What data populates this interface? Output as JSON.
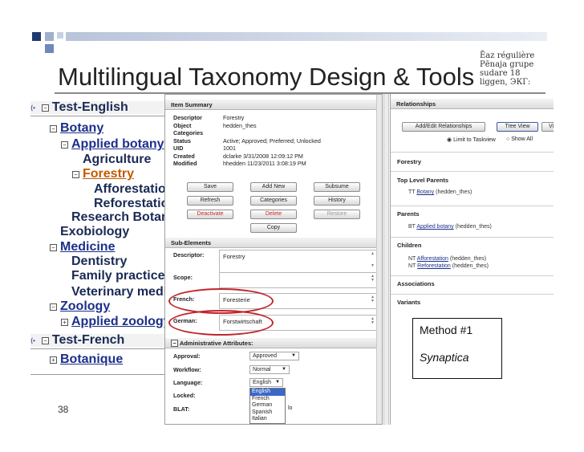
{
  "slide": {
    "title": "Multilingual Taxonomy Design & Tools",
    "page_number": "38",
    "stamp_lines": [
      "Ēaz régulière",
      "Pēnaja grupe",
      "sudare 18",
      "liggen, ЭКГ:"
    ]
  },
  "tree": {
    "rows": [
      {
        "label": "Test-English",
        "toggle": "⊟",
        "level": 0,
        "root": true,
        "style": ""
      },
      {
        "label": "Botany",
        "toggle": "⊟",
        "level": 1,
        "style": "u"
      },
      {
        "label": "Applied botany",
        "toggle": "⊟",
        "level": 2,
        "style": "u"
      },
      {
        "label": "Agriculture",
        "toggle": "",
        "level": 3,
        "style": ""
      },
      {
        "label": "Forestry",
        "toggle": "⊟",
        "level": 3,
        "style": "sel"
      },
      {
        "label": "Afforestation",
        "toggle": "",
        "level": 4,
        "style": ""
      },
      {
        "label": "Reforestation",
        "toggle": "",
        "level": 4,
        "style": ""
      },
      {
        "label": "Research Botany",
        "toggle": "",
        "level": 2,
        "style": ""
      },
      {
        "label": "Exobiology",
        "toggle": "",
        "level": 1,
        "style": ""
      },
      {
        "label": "Medicine",
        "toggle": "⊟",
        "level": 1,
        "style": "u"
      },
      {
        "label": "Dentistry",
        "toggle": "",
        "level": 2,
        "style": ""
      },
      {
        "label": "Family practice",
        "toggle": "",
        "level": 2,
        "style": ""
      },
      {
        "label": "Veterinary medicine",
        "toggle": "",
        "level": 2,
        "style": ""
      },
      {
        "label": "Zoology",
        "toggle": "⊟",
        "level": 1,
        "style": "u"
      },
      {
        "label": "Applied zoology",
        "toggle": "⊞",
        "level": 2,
        "style": "u"
      },
      {
        "label": "Test-French",
        "toggle": "⊟",
        "level": 0,
        "root": true,
        "style": ""
      },
      {
        "label": "Botanique",
        "toggle": "⊞",
        "level": 1,
        "style": "u"
      }
    ]
  },
  "item_summary": {
    "header": "Item Summary",
    "fields": [
      {
        "k": "Descriptor",
        "v": "Forestry"
      },
      {
        "k": "Object",
        "v": "hedden_thes"
      },
      {
        "k": "Categories",
        "v": ""
      },
      {
        "k": "Status",
        "v": "Active; Approved; Preferred; Unlocked"
      },
      {
        "k": "UID",
        "v": "1001"
      },
      {
        "k": "Created",
        "v": "dclarke 3/31/2008 12:09:12 PM"
      },
      {
        "k": "Modified",
        "v": "hhedden 11/23/2011 3:08:19 PM"
      }
    ],
    "buttons": {
      "save": "Save",
      "add_new": "Add New",
      "subsume": "Subsume",
      "refresh": "Refresh",
      "categories": "Categories",
      "history": "History",
      "deactivate": "Deactivate",
      "delete": "Delete",
      "restore": "Restore",
      "copy": "Copy"
    }
  },
  "sub_elements": {
    "header": "Sub-Elements",
    "descriptor_label": "Descriptor:",
    "descriptor_value": "Forestry",
    "scope_label": "Scope:",
    "scope_value": "",
    "french_label": "French:",
    "french_value": "Foresterie",
    "german_label": "German:",
    "german_value": "Forstwirtschaft"
  },
  "admin": {
    "header": "Administrative Attributes:",
    "approval_label": "Approval:",
    "approval_value": "Approved",
    "workflow_label": "Workflow:",
    "workflow_value": "Normal",
    "language_label": "Language:",
    "language_value": "English",
    "locked_label": "Locked:",
    "blat_label": "BLAT:",
    "blat_value": "lo",
    "language_options": [
      "English",
      "French",
      "German",
      "Spanish",
      "Italian"
    ]
  },
  "relationships": {
    "header": "Relationships",
    "add_edit_button": "Add/Edit Relationships",
    "tree_view_button": "Tree View",
    "third_button": "Vi",
    "limit_label": "Limit to Taskview",
    "show_all_label": "Show All",
    "term": "Forestry",
    "top_level_label": "Top Level Parents",
    "top_level_item": {
      "prefix": "TT",
      "link": "Botany",
      "suffix": "(hedden_thes)"
    },
    "parents_label": "Parents",
    "parents_item": {
      "prefix": "BT",
      "link": "Applied botany",
      "suffix": "(hedden_thes)"
    },
    "children_label": "Children",
    "children_items": [
      {
        "prefix": "NT",
        "link": "Afforestation",
        "suffix": "(hedden_thes)"
      },
      {
        "prefix": "NT",
        "link": "Reforestation",
        "suffix": "(hedden_thes)"
      }
    ],
    "associations_label": "Associations",
    "variants_label": "Variants"
  },
  "callout": {
    "line1": "Method #1",
    "line2": "Synaptica"
  },
  "colors": {
    "accent_blue": "#3a5a9f",
    "oval_red": "#c0262b",
    "link_blue": "#1c2f8a",
    "selected_orange": "#c25a00"
  }
}
